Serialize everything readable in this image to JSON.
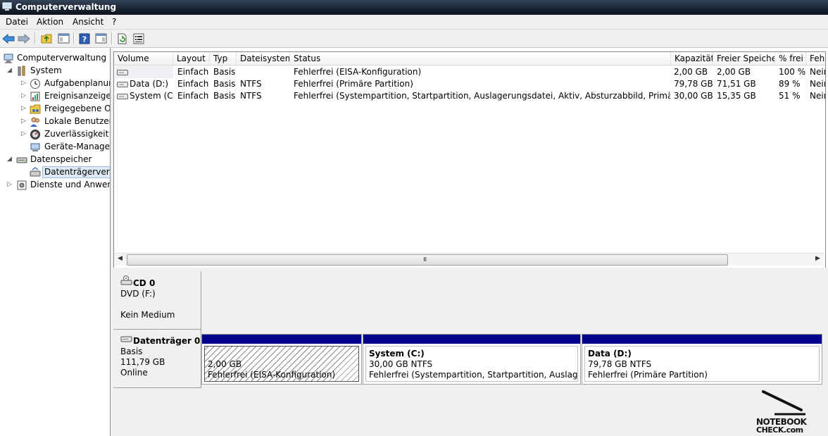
{
  "window": {
    "title": "Computerverwaltung"
  },
  "menu": [
    "Datei",
    "Aktion",
    "Ansicht",
    "?"
  ],
  "toolbar_icons": [
    "back-arrow-icon",
    "forward-arrow-icon",
    "up-folder-icon",
    "show-tree-icon",
    "help-icon",
    "action-pane-icon",
    "refresh-icon",
    "properties-icon"
  ],
  "tree": {
    "root": "Computerverwaltung (Lo",
    "system": "System",
    "system_children": [
      "Aufgabenplanung",
      "Ereignisanzeige",
      "Freigegebene Ord",
      "Lokale Benutzer u",
      "Zuverlässigkeit ur",
      "Geräte-Manager"
    ],
    "storage": "Datenspeicher",
    "disk_mgmt": "Datenträgerverwa",
    "services": "Dienste und Anwend"
  },
  "volume_table": {
    "headers": [
      "Volume",
      "Layout",
      "Typ",
      "Dateisystem",
      "Status",
      "Kapazität",
      "Freier Speicher",
      "% frei",
      "Feh"
    ],
    "rows": [
      {
        "volume": "",
        "layout": "Einfach",
        "type": "Basis",
        "fs": "",
        "status": "Fehlerfrei (EISA-Konfiguration)",
        "capacity": "2,00 GB",
        "free": "2,00 GB",
        "pct": "100 %",
        "fault": "Nein"
      },
      {
        "volume": "Data (D:)",
        "layout": "Einfach",
        "type": "Basis",
        "fs": "NTFS",
        "status": "Fehlerfrei (Primäre Partition)",
        "capacity": "79,78 GB",
        "free": "71,51 GB",
        "pct": "89 %",
        "fault": "Nein"
      },
      {
        "volume": "System (C:)",
        "layout": "Einfach",
        "type": "Basis",
        "fs": "NTFS",
        "status": "Fehlerfrei (Systempartition, Startpartition, Auslagerungsdatei, Aktiv, Absturzabbild, Primäre Partition)",
        "capacity": "30,00 GB",
        "free": "15,35 GB",
        "pct": "51 %",
        "fault": "Nein"
      }
    ],
    "scroll_grip": "III"
  },
  "disks": {
    "cd": {
      "name": "CD 0",
      "type": "DVD (F:)",
      "state": "Kein Medium"
    },
    "disk0": {
      "name": "Datenträger 0",
      "type": "Basis",
      "size": "111,79 GB",
      "state": "Online",
      "partitions": [
        {
          "label": "",
          "size": "2,00 GB",
          "status": "Fehlerfrei (EISA-Konfiguration)"
        },
        {
          "label": "System  (C:)",
          "size": "30,00 GB NTFS",
          "status": "Fehlerfrei (Systempartition, Startpartition, Auslagerungsdatei"
        },
        {
          "label": "Data  (D:)",
          "size": "79,78 GB NTFS",
          "status": "Fehlerfrei (Primäre Partition)"
        }
      ]
    }
  },
  "watermark": {
    "line1": "NOTEBOOK",
    "line2": "CHECK.com"
  }
}
